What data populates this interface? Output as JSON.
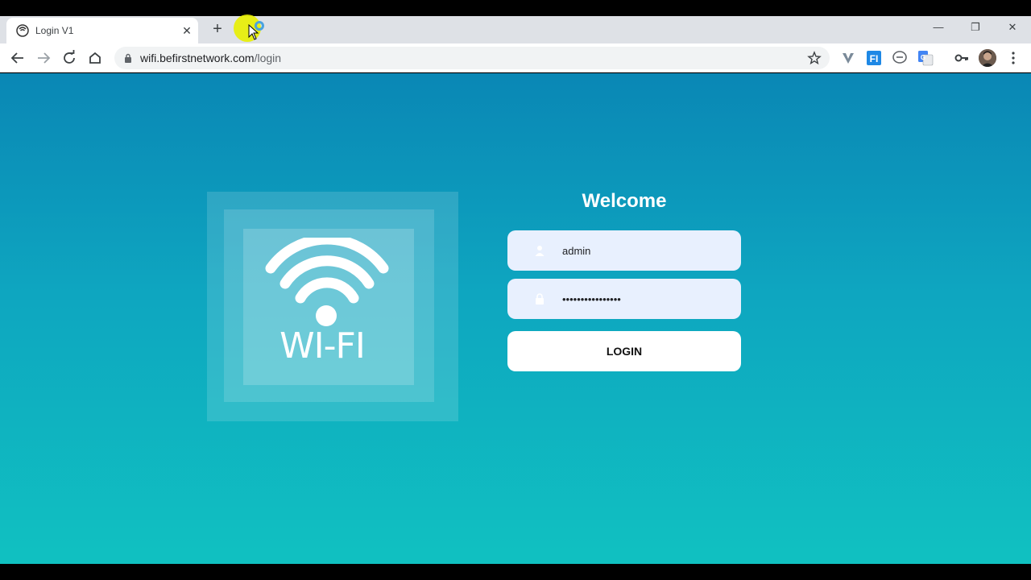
{
  "browser": {
    "tab": {
      "title": "Login V1",
      "close_glyph": "✕"
    },
    "new_tab_glyph": "+",
    "url": {
      "host": "wifi.befirstnetwork.com",
      "path": "/login"
    },
    "window_controls": {
      "minimize": "—",
      "restore": "❐",
      "close": "✕"
    },
    "extensions": [
      "vimium-icon",
      "fi-extension-icon",
      "line-extension-icon",
      "google-translate-icon",
      "key-icon"
    ]
  },
  "page": {
    "logo_text": "WI-FI",
    "welcome": "Welcome",
    "username": {
      "value": "admin"
    },
    "password": {
      "value": "••••••••••••••••"
    },
    "login_label": "LOGIN"
  },
  "colors": {
    "gradient_top": "#0a87b5",
    "gradient_bottom": "#10c1c1",
    "field_bg": "#e8f0fe"
  }
}
